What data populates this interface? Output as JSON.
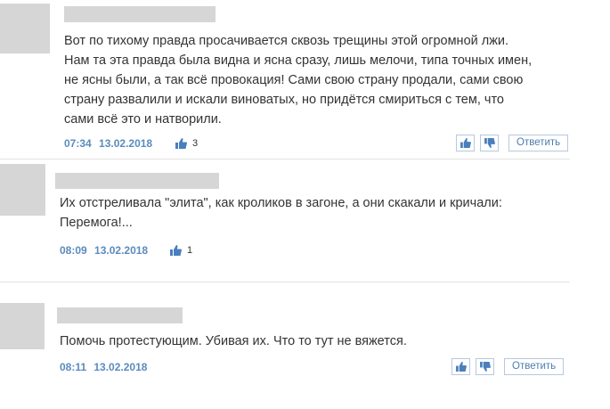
{
  "comments": [
    {
      "author": "",
      "text_lines": [
        "Вот по тихому правда просачивается сквозь трещины этой огромной лжи.",
        "Нам та эта правда была видна и ясна сразу, лишь мелочи, типа точных имен,",
        "не ясны были, а так всё провокация! Сами свою страну продали, сами свою",
        "страну развалили и искали виноватых, но придётся смириться с тем, что",
        "сами всё это и натворили."
      ],
      "time": "07:34",
      "date": "13.02.2018",
      "likes": "3",
      "reply_label": "Ответить"
    },
    {
      "author": "",
      "text_lines": [
        "Их отстреливала \"элита\", как кроликов в загоне, а они скакали и кричали:",
        "Перемога!..."
      ],
      "time": "08:09",
      "date": "13.02.2018",
      "likes": "1"
    },
    {
      "author": "",
      "text_lines": [
        "Помочь протестующим. Убивая их. Что то тут не вяжется."
      ],
      "time": "08:11",
      "date": "13.02.2018",
      "likes": "",
      "reply_label": "Ответить"
    }
  ],
  "colors": {
    "accent": "#5b8bbd",
    "icon": "#4a7fbd",
    "placeholder": "#d6d6d6",
    "border": "#b7c9dd"
  },
  "icons": {
    "like": "thumbs-up-icon",
    "dislike": "thumbs-down-icon"
  }
}
